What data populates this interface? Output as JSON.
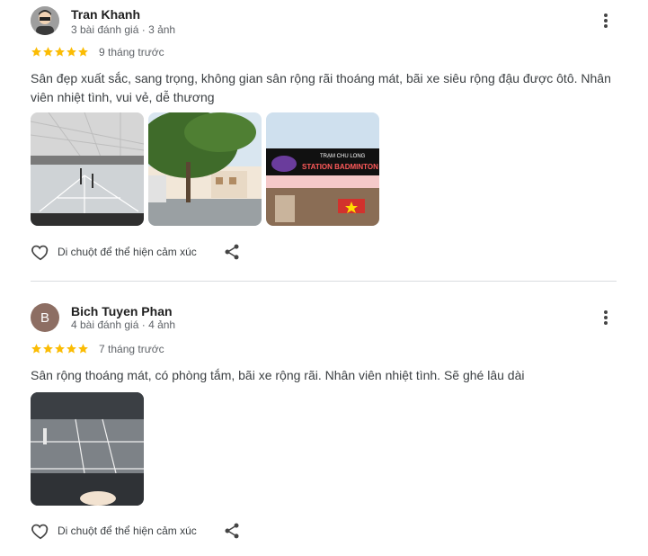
{
  "colors": {
    "star": "#fbbc04",
    "avatar_b": "#8d6e63",
    "divider": "#dadce0"
  },
  "reviews": [
    {
      "name": "Tran Khanh",
      "meta": "3 bài đánh giá · 3 ảnh",
      "rating": 5,
      "time": "9 tháng trước",
      "text": "Sân đẹp xuất sắc, sang trọng, không gian sân rộng rãi thoáng mát, bãi xe siêu rộng đậu được ôtô. Nhân viên nhiệt tình, vui vẻ, dễ thương",
      "react_label": "Di chuột để thể hiện cảm xúc",
      "photos": [
        "indoor-badminton-hall",
        "parking-lot-with-tree",
        "storefront-sign"
      ],
      "sign_text": "TRẠM CHU LONG",
      "sign_text_2": "STATION BADMINTON"
    },
    {
      "name": "Bich Tuyen Phan",
      "avatar_letter": "B",
      "meta": "4 bài đánh giá · 4 ảnh",
      "rating": 5,
      "time": "7 tháng trước",
      "text": "Sân rộng thoáng mát, có phòng tắm, bãi xe rộng rãi. Nhân viên nhiệt tình. Sẽ ghé lâu dài",
      "react_label": "Di chuột để thể hiện cảm xúc",
      "photos": [
        "badminton-court-grey"
      ]
    }
  ],
  "icons": {
    "more": "more-vert-icon",
    "heart": "heart-icon",
    "share": "share-icon",
    "star": "star-icon"
  }
}
